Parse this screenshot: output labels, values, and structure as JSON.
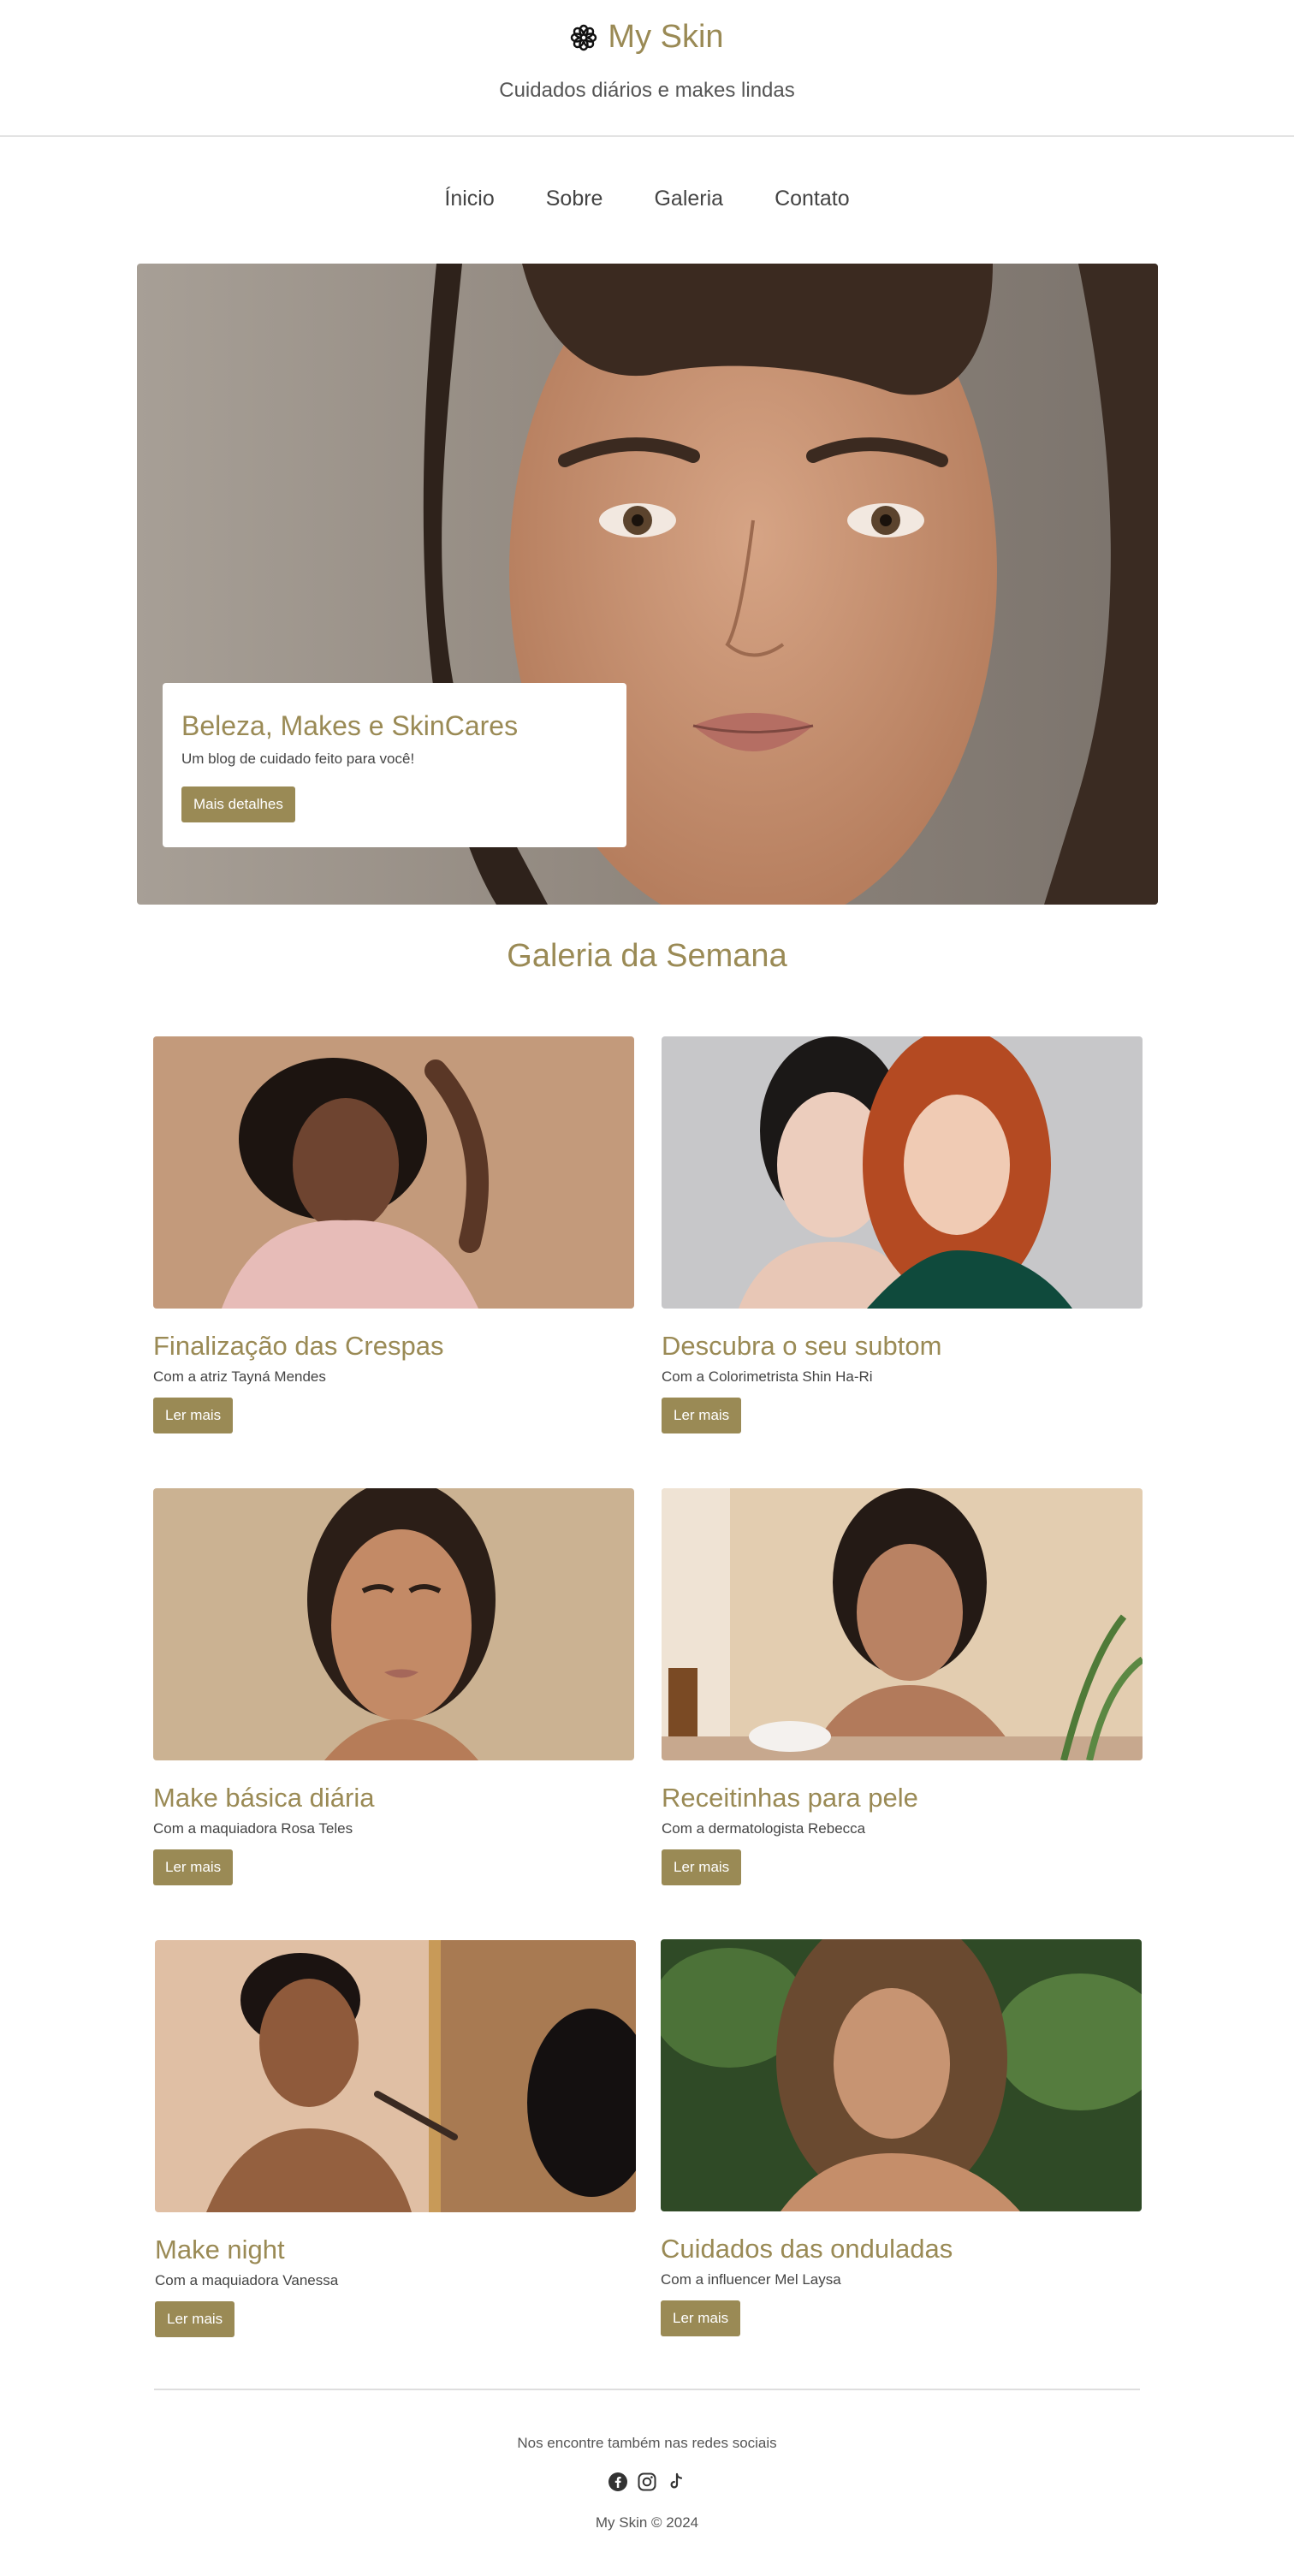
{
  "header": {
    "brand_icon": "flower-icon",
    "title": "My Skin",
    "tagline": "Cuidados diários e makes lindas"
  },
  "nav": {
    "items": [
      {
        "label": "Ínicio"
      },
      {
        "label": "Sobre"
      },
      {
        "label": "Galeria"
      },
      {
        "label": "Contato"
      }
    ]
  },
  "hero": {
    "title": "Beleza, Makes e SkinCares",
    "subtitle": "Um blog de cuidado feito para você!",
    "button": "Mais detalhes"
  },
  "gallery": {
    "title": "Galeria da Semana",
    "cards": [
      {
        "title": "Finalização das Crespas",
        "subtitle": "Com a atriz Tayná Mendes",
        "button": "Ler mais"
      },
      {
        "title": "Descubra o seu subtom",
        "subtitle": "Com a Colorimetrista Shin Ha-Ri",
        "button": "Ler mais"
      },
      {
        "title": "Make básica diária",
        "subtitle": "Com a maquiadora Rosa Teles",
        "button": "Ler mais"
      },
      {
        "title": "Receitinhas para pele",
        "subtitle": "Com a dermatologista Rebecca",
        "button": "Ler mais"
      },
      {
        "title": "Make night",
        "subtitle": "Com a maquiadora Vanessa",
        "button": "Ler mais"
      },
      {
        "title": "Cuidados das onduladas",
        "subtitle": "Com a influencer Mel Laysa",
        "button": "Ler mais"
      }
    ]
  },
  "footer": {
    "social_text": "Nos encontre também nas redes sociais",
    "social_icons": [
      "facebook-icon",
      "instagram-icon",
      "tiktok-icon"
    ],
    "copyright": "My Skin © 2024"
  },
  "colors": {
    "accent": "#9a8a55",
    "text": "#444444"
  }
}
